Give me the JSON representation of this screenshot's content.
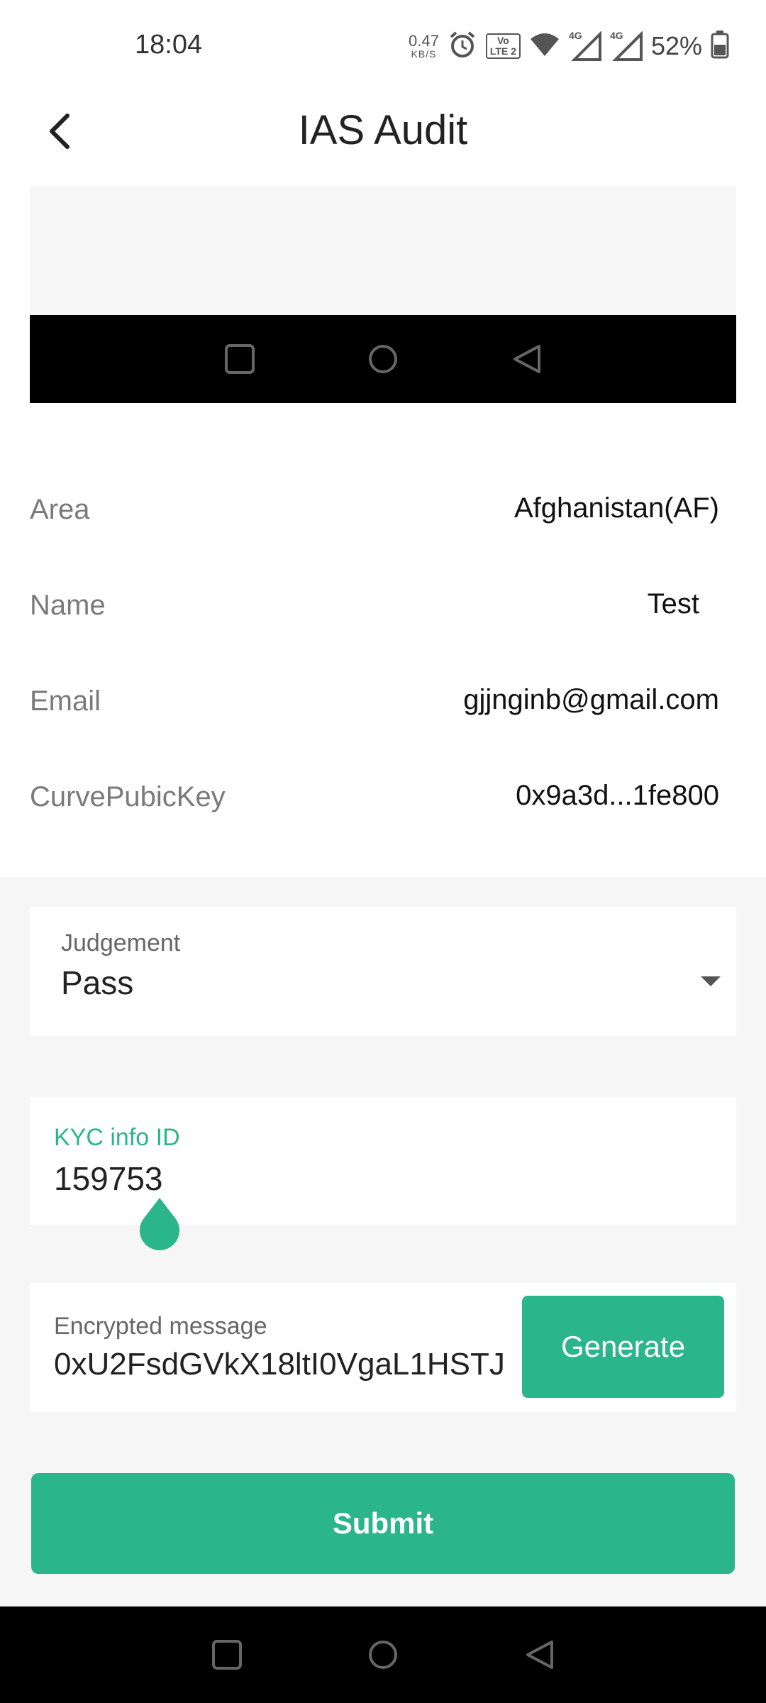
{
  "status_bar": {
    "time": "18:04",
    "net_speed": "0.47",
    "net_speed_unit": "KB/S",
    "volte_label_top": "Vo",
    "volte_label_bottom": "LTE 2",
    "sim1_tag": "4G",
    "sim2_tag": "4G",
    "battery": "52%"
  },
  "header": {
    "title": "IAS Audit"
  },
  "info": {
    "rows": [
      {
        "label": "Area",
        "value": "Afghanistan(AF)"
      },
      {
        "label": "Name",
        "value": "Test"
      },
      {
        "label": "Email",
        "value": "gjjnginb@gmail.com"
      },
      {
        "label": "CurvePubicKey",
        "value": "0x9a3d...1fe800"
      }
    ]
  },
  "form": {
    "judgement": {
      "label": "Judgement",
      "value": "Pass"
    },
    "kyc": {
      "label": "KYC info ID",
      "value": "159753"
    },
    "encrypted": {
      "label": "Encrypted message",
      "value": "0xU2FsdGVkX18ltI0VgaL1HSTJ"
    },
    "generate_label": "Generate",
    "submit_label": "Submit"
  },
  "colors": {
    "accent": "#2bb58a",
    "form_bg": "#f6f6f6"
  },
  "icons": {
    "back": "chevron-left-icon",
    "dropdown": "caret-down-icon",
    "nav_recent": "square-icon",
    "nav_home": "circle-icon",
    "nav_back": "triangle-left-icon"
  }
}
